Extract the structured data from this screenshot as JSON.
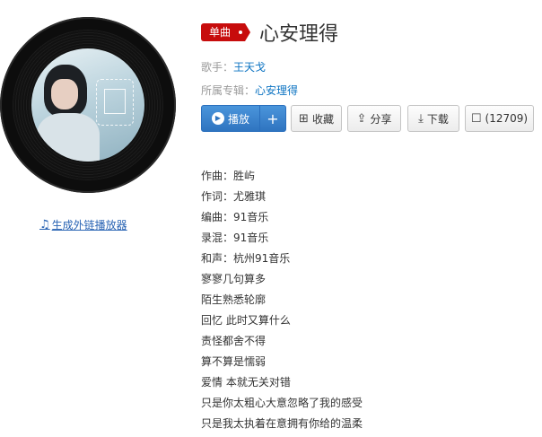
{
  "cover": {
    "alt": "album cover"
  },
  "external_link_label": "生成外链播放器",
  "song": {
    "type_badge": "单曲",
    "title": "心安理得",
    "singer_label": "歌手：",
    "singer": "王天戈",
    "album_label": "所属专辑：",
    "album": "心安理得"
  },
  "actions": {
    "play_label": "播放",
    "add_label": "+",
    "favorite_label": "收藏",
    "share_label": "分享",
    "download_label": "下载",
    "comment_label": "(12709)"
  },
  "icons": {
    "music_note": "♫",
    "play": "▶",
    "favorite": "⊞",
    "share": "⇪",
    "download": "⤓",
    "comment": "☐"
  },
  "colors": {
    "badge_red": "#c70c0c",
    "play_blue": "#2f74c0",
    "link_blue": "#0c73c2"
  },
  "lyrics": [
    "作曲：胜屿",
    "作词：尤雅琪",
    "编曲：91音乐",
    "录混：91音乐",
    "和声：杭州91音乐",
    "寥寥几句算多",
    "陌生熟悉轮廓",
    "回忆 此时又算什么",
    "责怪都舍不得",
    "算不算是懦弱",
    "爱情 本就无关对错",
    "只是你太粗心大意忽略了我的感受",
    "只是我太执着在意拥有你给的温柔"
  ]
}
